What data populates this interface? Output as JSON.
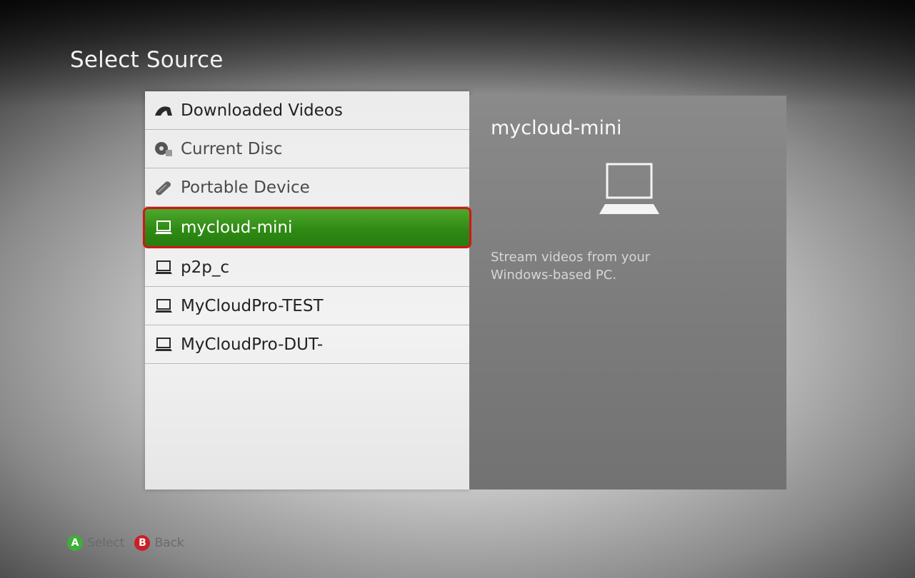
{
  "page": {
    "title": "Select Source"
  },
  "sources": [
    {
      "label": "Downloaded Videos",
      "icon": "download-icon"
    },
    {
      "label": "Current Disc",
      "icon": "disc-icon"
    },
    {
      "label": "Portable Device",
      "icon": "portable-device-icon"
    },
    {
      "label": "mycloud-mini",
      "icon": "laptop-icon",
      "selected": true
    },
    {
      "label": "p2p_c",
      "icon": "laptop-icon"
    },
    {
      "label": "MyCloudPro-TEST",
      "icon": "laptop-icon"
    },
    {
      "label": "MyCloudPro-DUT-",
      "icon": "laptop-icon"
    }
  ],
  "detail": {
    "title": "mycloud-mini",
    "icon": "laptop-icon",
    "description": "Stream videos from your Windows-based PC."
  },
  "footer": {
    "select_glyph": "A",
    "select_label": "Select",
    "back_glyph": "B",
    "back_label": "Back"
  },
  "colors": {
    "selection_green": "#2f8a14",
    "selection_outline": "#d21616",
    "a_button": "#3fae3a",
    "b_button": "#c8202a"
  }
}
